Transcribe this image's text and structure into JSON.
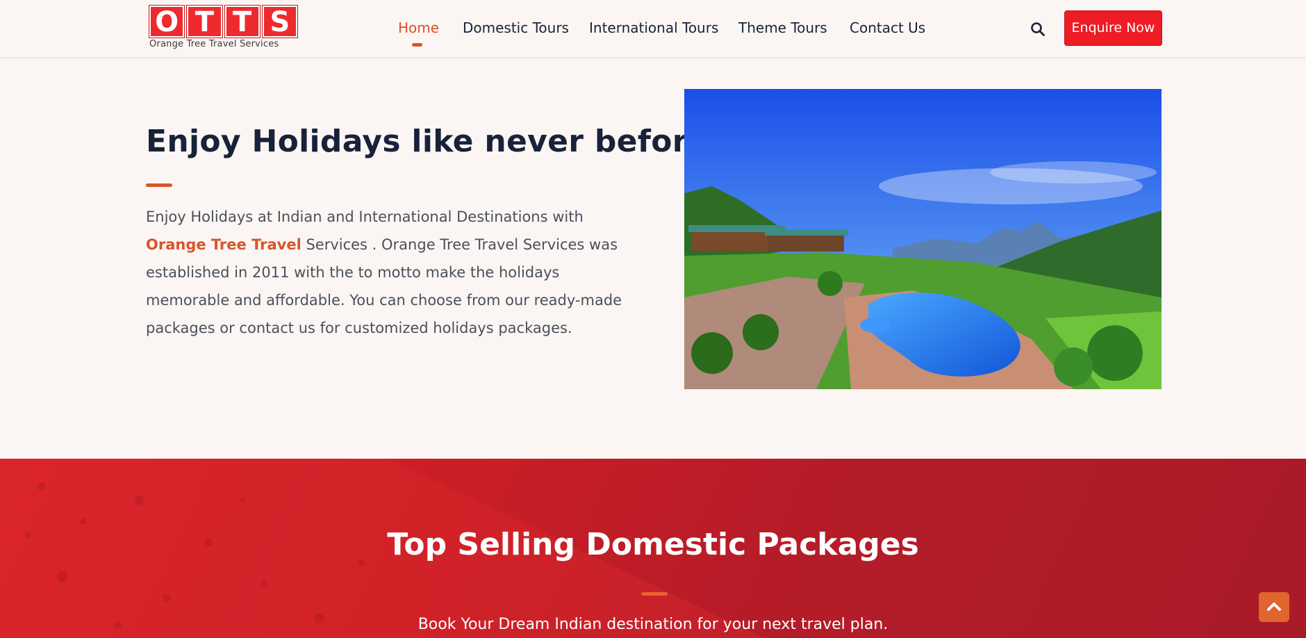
{
  "brand": {
    "letters": [
      "O",
      "T",
      "T",
      "S"
    ],
    "tagline": "Orange Tree Travel Services"
  },
  "nav": {
    "items": [
      {
        "label": "Home",
        "active": true
      },
      {
        "label": "Domestic Tours",
        "active": false
      },
      {
        "label": "International Tours",
        "active": false
      },
      {
        "label": "Theme Tours",
        "active": false
      },
      {
        "label": "Contact Us",
        "active": false
      }
    ],
    "search_icon": "search-icon",
    "enquire_label": "Enquire Now"
  },
  "hero": {
    "title": "Enjoy Holidays like never before",
    "text_before": "Enjoy Holidays at Indian and International Destinations with ",
    "highlight": "Orange Tree Travel",
    "text_after": " Services . Orange Tree Travel Services was established in 2011 with the to motto make the holidays memorable and affordable. You can choose from our ready-made packages or contact us for customized holidays packages."
  },
  "domestic": {
    "title": "Top Selling Domestic Packages",
    "subtitle": "Book Your Dream Indian destination for your next travel plan."
  },
  "scroll_top_icon": "chevron-up-icon",
  "colors": {
    "accent": "#d9542a",
    "brand_red": "#ee1c25",
    "navy": "#18223a",
    "background": "#fbf6f3"
  }
}
